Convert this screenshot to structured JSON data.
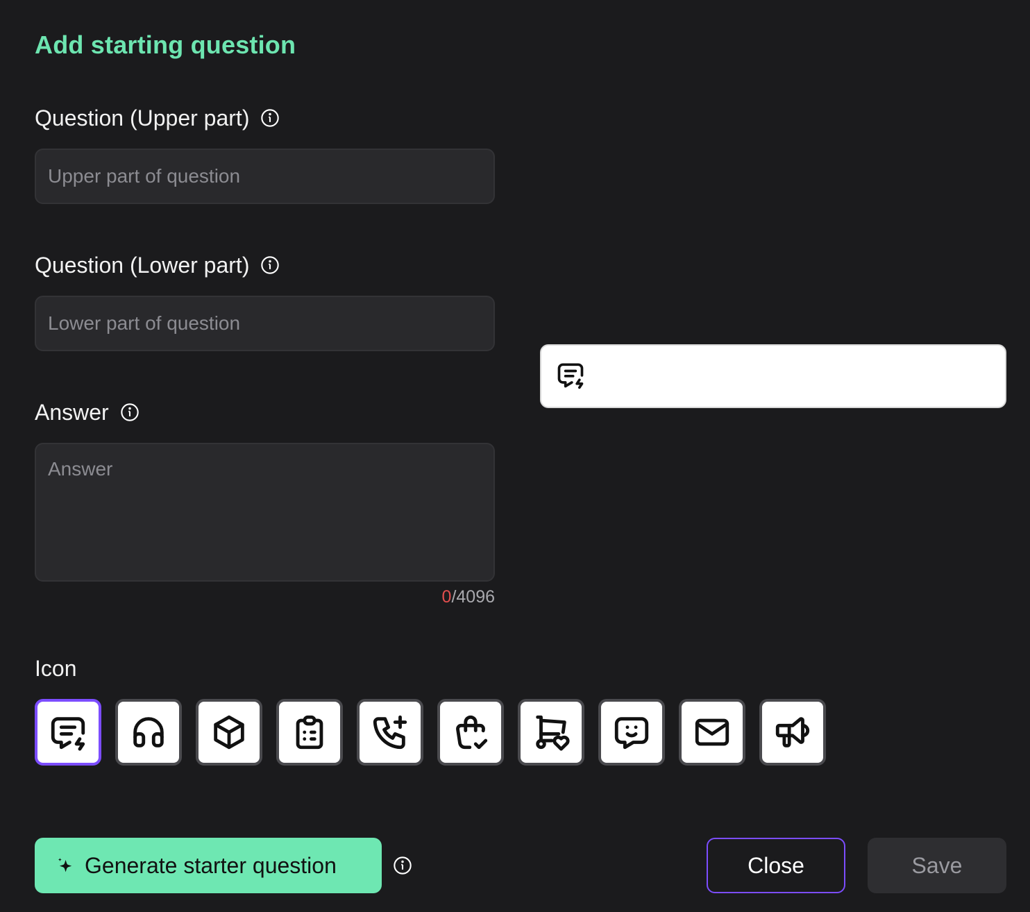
{
  "dialog": {
    "title": "Add starting question"
  },
  "fields": {
    "upper": {
      "label": "Question (Upper part)",
      "value": "",
      "placeholder": "Upper part of question"
    },
    "lower": {
      "label": "Question (Lower part)",
      "value": "",
      "placeholder": "Lower part of question"
    },
    "answer": {
      "label": "Answer",
      "value": "",
      "placeholder": "Answer",
      "char_count": "0",
      "char_limit": "/4096"
    }
  },
  "preview": {
    "icon": "message-bolt-icon"
  },
  "icon_picker": {
    "label": "Icon",
    "selected": "message-bolt-icon",
    "icons": [
      "message-bolt-icon",
      "headphones-icon",
      "box-icon",
      "clipboard-list-icon",
      "phone-plus-icon",
      "shopping-bag-check-icon",
      "cart-heart-icon",
      "message-smile-icon",
      "mail-icon",
      "megaphone-icon"
    ]
  },
  "actions": {
    "generate_label": "Generate starter question",
    "close_label": "Close",
    "save_label": "Save"
  },
  "colors": {
    "accent": "#6de5b0",
    "selection": "#7c4dff",
    "counter_zero": "#e24e4e",
    "background": "#1b1b1d"
  }
}
